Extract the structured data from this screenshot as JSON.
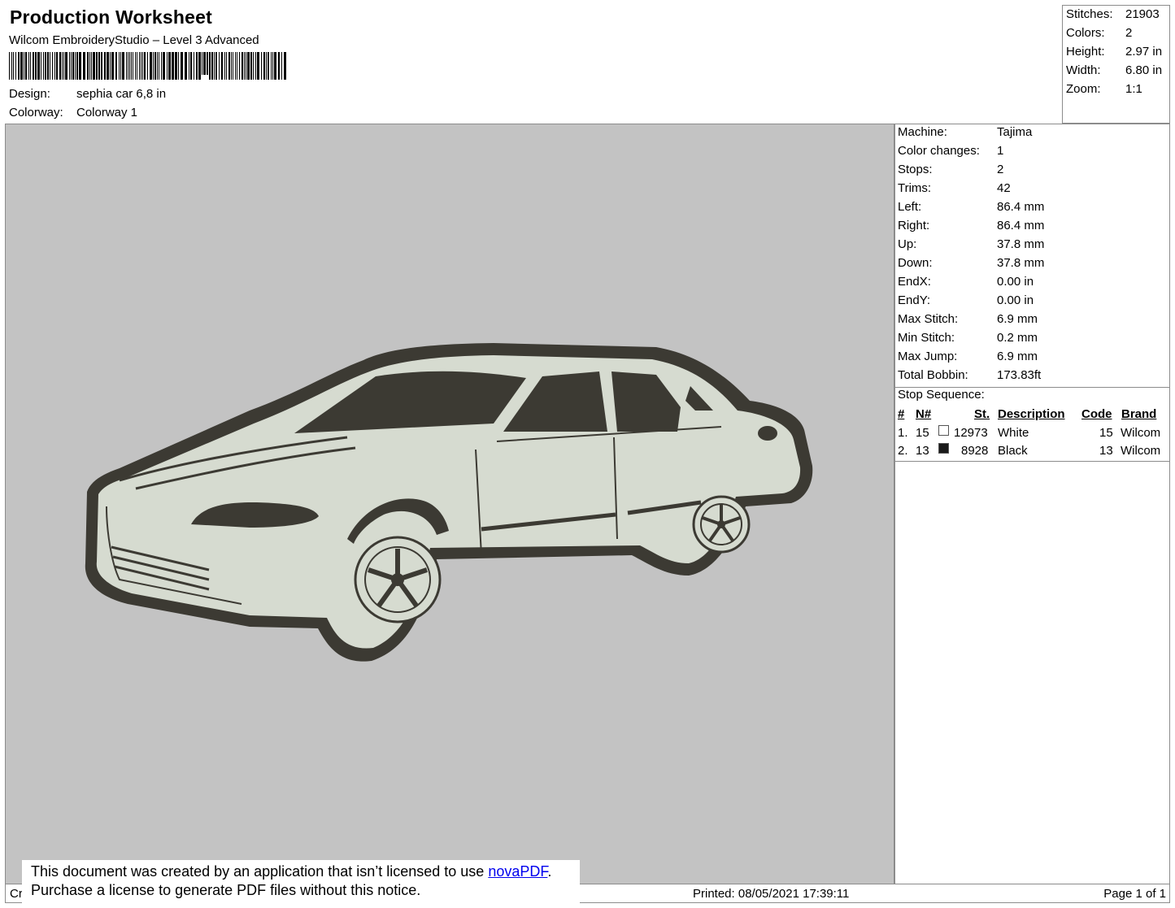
{
  "header": {
    "title": "Production Worksheet",
    "subtitle": "Wilcom EmbroideryStudio – Level 3 Advanced",
    "design_label": "Design:",
    "design_value": "sephia car 6,8 in",
    "colorway_label": "Colorway:",
    "colorway_value": "Colorway 1"
  },
  "stats": [
    {
      "label": "Stitches:",
      "value": "21903"
    },
    {
      "label": "Colors:",
      "value": "2"
    },
    {
      "label": "Height:",
      "value": "2.97 in"
    },
    {
      "label": "Width:",
      "value": "6.80 in"
    },
    {
      "label": "Zoom:",
      "value": "1:1"
    }
  ],
  "machine_info": [
    {
      "label": "Machine:",
      "value": "Tajima"
    },
    {
      "label": "Color changes:",
      "value": "1"
    },
    {
      "label": "Stops:",
      "value": "2"
    },
    {
      "label": "Trims:",
      "value": "42"
    },
    {
      "label": "Left:",
      "value": "86.4 mm"
    },
    {
      "label": "Right:",
      "value": "86.4 mm"
    },
    {
      "label": "Up:",
      "value": "37.8 mm"
    },
    {
      "label": "Down:",
      "value": "37.8 mm"
    },
    {
      "label": "EndX:",
      "value": "0.00 in"
    },
    {
      "label": "EndY:",
      "value": "0.00 in"
    },
    {
      "label": "Max Stitch:",
      "value": "6.9 mm"
    },
    {
      "label": "Min Stitch:",
      "value": "0.2 mm"
    },
    {
      "label": "Max Jump:",
      "value": "6.9 mm"
    },
    {
      "label": "Total Bobbin:",
      "value": "173.83ft"
    }
  ],
  "stop_sequence": {
    "title": "Stop Sequence:",
    "columns": [
      "#",
      "N#",
      "St.",
      "Description",
      "Code",
      "Brand"
    ],
    "rows": [
      {
        "index": "1.",
        "n": "15",
        "swatch": "#ffffff",
        "stitches": "12973",
        "description": "White",
        "code": "15",
        "brand": "Wilcom"
      },
      {
        "index": "2.",
        "n": "13",
        "swatch": "#1a1a1a",
        "stitches": "8928",
        "description": "Black",
        "code": "13",
        "brand": "Wilcom"
      }
    ]
  },
  "preview": {
    "background": "#c3c3c3",
    "thread_light": "#d6dbd0",
    "thread_dark": "#3c3a33"
  },
  "footer": {
    "left_text": "Cr",
    "printed": "Printed: 08/05/2021 17:39:11",
    "page": "Page 1 of 1"
  },
  "notice": {
    "line1_prefix": "This document was created by an application that isn’t licensed to use ",
    "link_text": "novaPDF",
    "line1_suffix": ".",
    "line2": "Purchase a license to generate PDF files without this notice."
  }
}
